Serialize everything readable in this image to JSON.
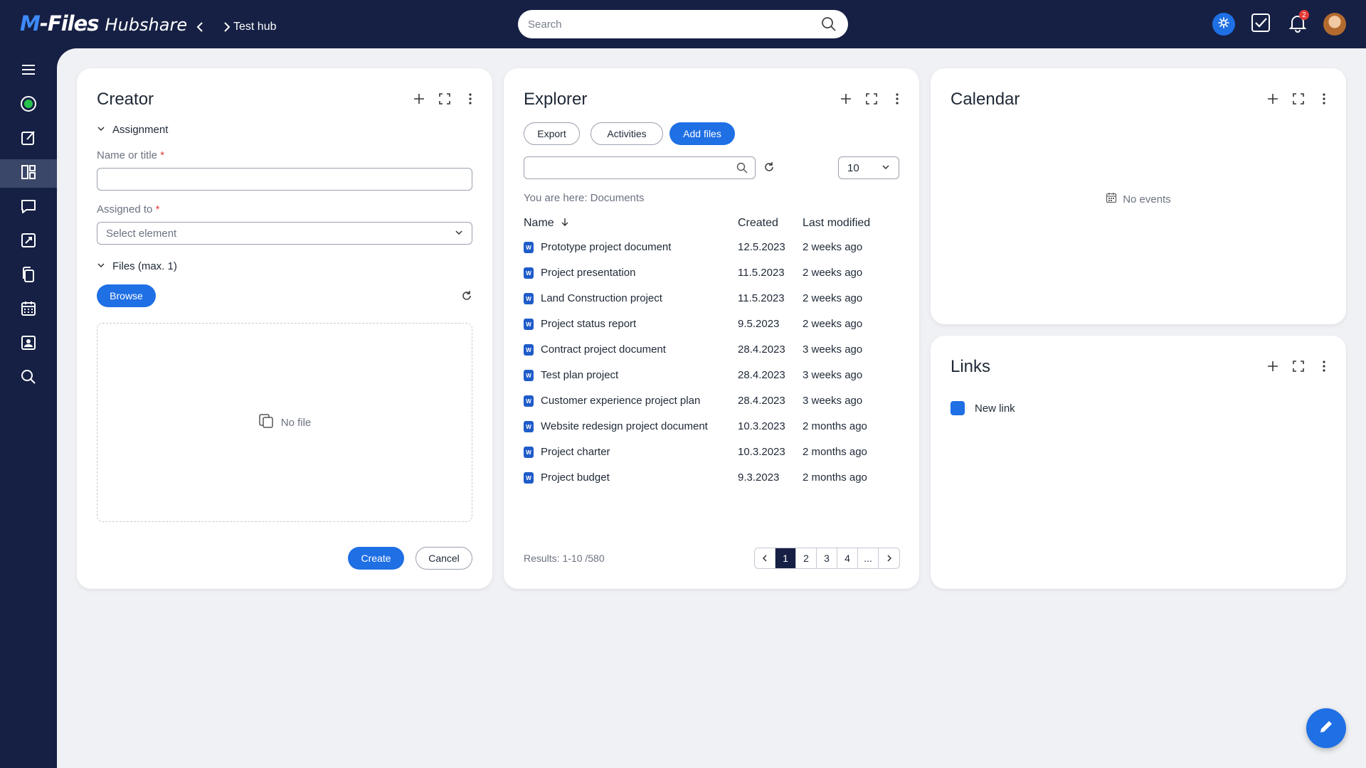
{
  "brand": {
    "name_mark": "M",
    "name_rest": "-Files",
    "product": "Hubshare"
  },
  "breadcrumb": {
    "current": "Test hub"
  },
  "search": {
    "placeholder": "Search"
  },
  "notifications": {
    "count": "2"
  },
  "colors": {
    "navy": "#162044",
    "accent": "#1f6fe5",
    "required": "#e53935"
  },
  "sidebar": {
    "items": [
      {
        "icon": "menu-icon"
      },
      {
        "icon": "status-circle-icon"
      },
      {
        "icon": "edit-note-icon"
      },
      {
        "icon": "dashboard-icon",
        "active": true
      },
      {
        "icon": "chat-icon"
      },
      {
        "icon": "rocket-icon"
      },
      {
        "icon": "documents-icon"
      },
      {
        "icon": "calendar-icon"
      },
      {
        "icon": "contact-card-icon"
      },
      {
        "icon": "search-icon"
      }
    ]
  },
  "creator": {
    "title": "Creator",
    "assignment_label": "Assignment",
    "name_label": "Name or title",
    "required_mark": "*",
    "assigned_label": "Assigned to",
    "select_placeholder": "Select element",
    "files_label": "Files (max. 1)",
    "browse": "Browse",
    "no_file": "No file",
    "create": "Create",
    "cancel": "Cancel"
  },
  "explorer": {
    "title": "Explorer",
    "buttons": {
      "export": "Export",
      "activities": "Activities",
      "add_files": "Add files"
    },
    "page_size": "10",
    "location": "You are here: Documents",
    "columns": {
      "name": "Name",
      "created": "Created",
      "modified": "Last modified"
    },
    "file_icon_letter": "W",
    "rows": [
      {
        "name": "Prototype project document",
        "created": "12.5.2023",
        "modified": "2 weeks ago"
      },
      {
        "name": "Project presentation",
        "created": "11.5.2023",
        "modified": "2 weeks ago"
      },
      {
        "name": "Land Construction project",
        "created": "11.5.2023",
        "modified": "2 weeks ago"
      },
      {
        "name": "Project status report",
        "created": "9.5.2023",
        "modified": "2 weeks ago"
      },
      {
        "name": "Contract project document",
        "created": "28.4.2023",
        "modified": "3 weeks ago"
      },
      {
        "name": "Test plan project",
        "created": "28.4.2023",
        "modified": "3 weeks ago"
      },
      {
        "name": "Customer experience project plan",
        "created": "28.4.2023",
        "modified": "3 weeks ago"
      },
      {
        "name": "Website redesign project document",
        "created": "10.3.2023",
        "modified": "2 months ago"
      },
      {
        "name": "Project charter",
        "created": "10.3.2023",
        "modified": "2 months ago"
      },
      {
        "name": "Project budget",
        "created": "9.3.2023",
        "modified": "2 months ago"
      }
    ],
    "results": "Results: 1-10 /580",
    "pages": [
      "1",
      "2",
      "3",
      "4",
      "..."
    ],
    "current_page": "1"
  },
  "calendar": {
    "title": "Calendar",
    "empty": "No events"
  },
  "links": {
    "title": "Links",
    "items": [
      {
        "label": "New link"
      }
    ]
  }
}
